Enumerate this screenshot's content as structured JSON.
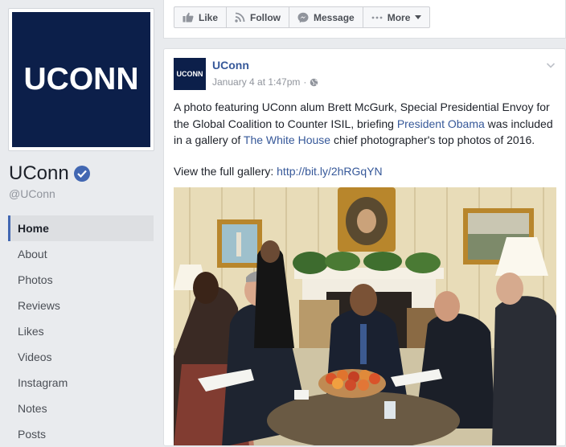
{
  "page": {
    "profile_logo_text": "UCONN",
    "name": "UConn",
    "handle": "@UConn",
    "verified": true
  },
  "nav": {
    "items": [
      {
        "label": "Home",
        "active": true
      },
      {
        "label": "About"
      },
      {
        "label": "Photos"
      },
      {
        "label": "Reviews"
      },
      {
        "label": "Likes"
      },
      {
        "label": "Videos"
      },
      {
        "label": "Instagram"
      },
      {
        "label": "Notes"
      },
      {
        "label": "Posts"
      }
    ]
  },
  "actions": {
    "like": "Like",
    "follow": "Follow",
    "message": "Message",
    "more": "More"
  },
  "post": {
    "author": "UConn",
    "avatar_text": "UCONN",
    "timestamp": "January 4 at 1:47pm",
    "text_part1": "A photo featuring UConn alum Brett McGurk, Special Presidential Envoy for the Global Coalition to Counter ISIL, briefing ",
    "mention1": "President Obama",
    "text_part2": " was included in a gallery of ",
    "mention2": "The White House",
    "text_part3": " chief photographer's top photos of 2016.",
    "link_label": "View the full gallery: ",
    "link_url": "http://bit.ly/2hRGqYN"
  },
  "colors": {
    "brand_navy": "#0c1f4a",
    "facebook_blue": "#4267b2",
    "link_blue": "#365899",
    "background": "#e9ebee"
  },
  "icons": {
    "like": "thumbs-up-icon",
    "follow": "rss-icon",
    "message": "chat-bubble-icon",
    "more": "dots-icon",
    "privacy": "globe-icon",
    "options": "chevron-down-icon",
    "verified": "check-badge-icon"
  }
}
